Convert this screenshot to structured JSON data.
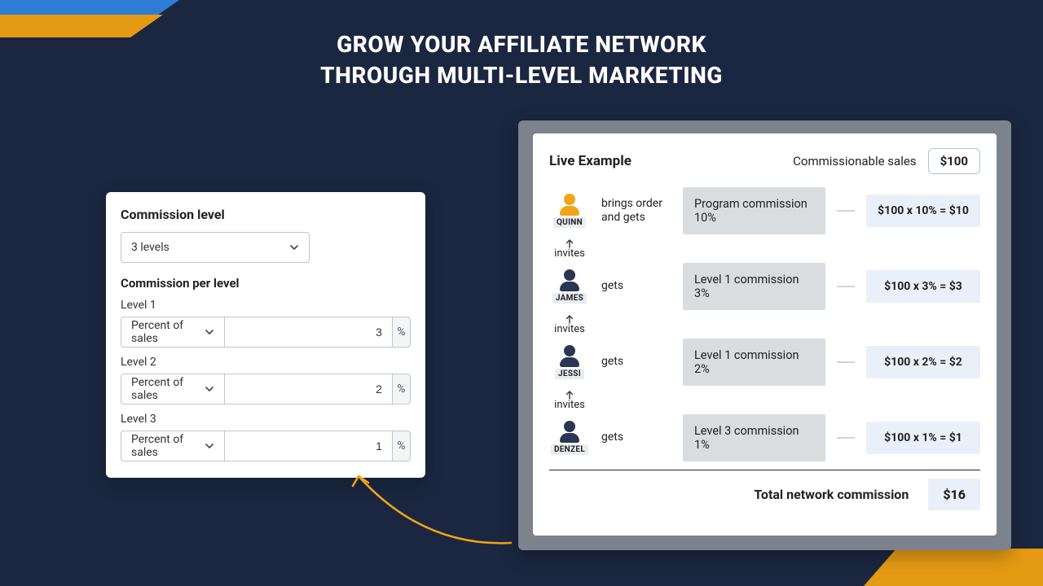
{
  "heading": {
    "line1": "GROW YOUR AFFILIATE NETWORK",
    "line2": "THROUGH MULTI-LEVEL MARKETING"
  },
  "panel": {
    "title": "Commission level",
    "levels_option": "3 levels",
    "per_level_title": "Commission per level",
    "type_option": "Percent of sales",
    "unit": "%",
    "levels": [
      {
        "label": "Level 1",
        "value": "3"
      },
      {
        "label": "Level 2",
        "value": "2"
      },
      {
        "label": "Level 3",
        "value": "1"
      }
    ]
  },
  "example": {
    "title": "Live Example",
    "sales_label": "Commissionable sales",
    "sales_amount": "$100",
    "invites_label": "invites",
    "rows": [
      {
        "name": "QUINN",
        "avatar": "orange",
        "action": "brings order and gets",
        "commission_label": "Program commission 10%",
        "calc": "$100 x 10% = $10"
      },
      {
        "name": "JAMES",
        "avatar": "navy",
        "action": "gets",
        "commission_label": "Level 1 commission 3%",
        "calc": "$100 x 3% = $3"
      },
      {
        "name": "JESSI",
        "avatar": "navy",
        "action": "gets",
        "commission_label": "Level 1 commission 2%",
        "calc": "$100 x 2% = $2"
      },
      {
        "name": "DENZEL",
        "avatar": "navy",
        "action": "gets",
        "commission_label": "Level 3 commission 1%",
        "calc": "$100 x 1% = $1"
      }
    ],
    "total_label": "Total network commission",
    "total_value": "$16"
  }
}
